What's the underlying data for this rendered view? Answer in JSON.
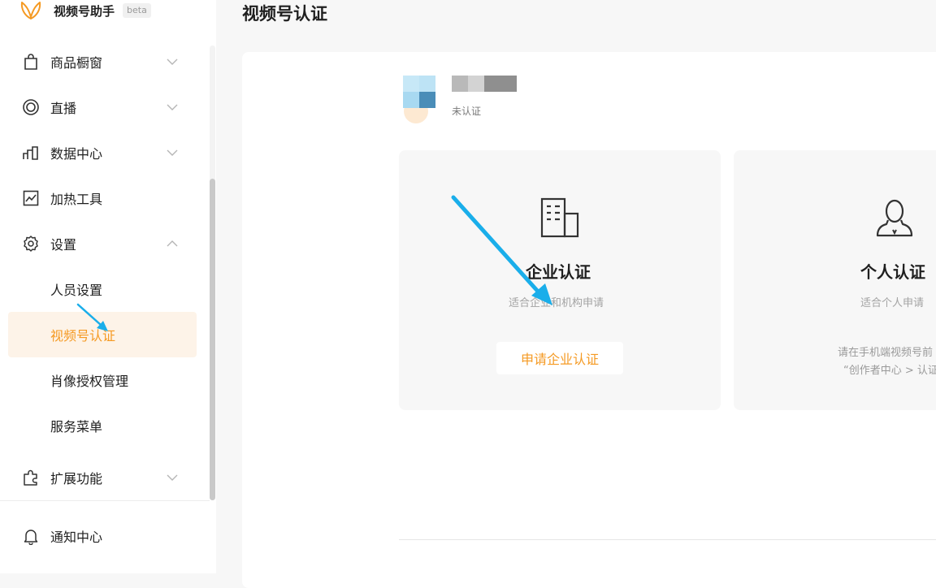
{
  "brand": {
    "name": "视频号助手",
    "badge": "beta"
  },
  "sidebar": {
    "items": [
      {
        "label": "商品橱窗",
        "icon": "shopping-bag-icon",
        "expandable": true
      },
      {
        "label": "直播",
        "icon": "live-icon",
        "expandable": true
      },
      {
        "label": "数据中心",
        "icon": "bar-chart-icon",
        "expandable": true
      },
      {
        "label": "加热工具",
        "icon": "trend-chart-icon",
        "expandable": false
      },
      {
        "label": "设置",
        "icon": "gear-icon",
        "expandable": true,
        "expanded": true
      },
      {
        "label": "人员设置",
        "sub": true
      },
      {
        "label": "视频号认证",
        "sub": true,
        "active": true
      },
      {
        "label": "肖像授权管理",
        "sub": true
      },
      {
        "label": "服务菜单",
        "sub": true
      },
      {
        "label": "扩展功能",
        "icon": "puzzle-icon",
        "expandable": true
      }
    ],
    "footer_item": {
      "label": "通知中心",
      "icon": "bell-icon"
    }
  },
  "page": {
    "title": "视频号认证"
  },
  "account": {
    "status": "未认证"
  },
  "cards": {
    "enterprise": {
      "title": "企业认证",
      "description": "适合企业和机构申请",
      "button": "申请企业认证",
      "icon": "building-icon"
    },
    "personal": {
      "title": "个人认证",
      "description": "适合个人申请",
      "hint_line1": "请在手机端视频号前",
      "hint_line2": "“创作者中心 > 认证",
      "icon": "person-icon"
    }
  },
  "colors": {
    "accent": "#f59a23",
    "active_bg": "#fdf3e8",
    "annotation_arrow": "#1aaeea"
  }
}
